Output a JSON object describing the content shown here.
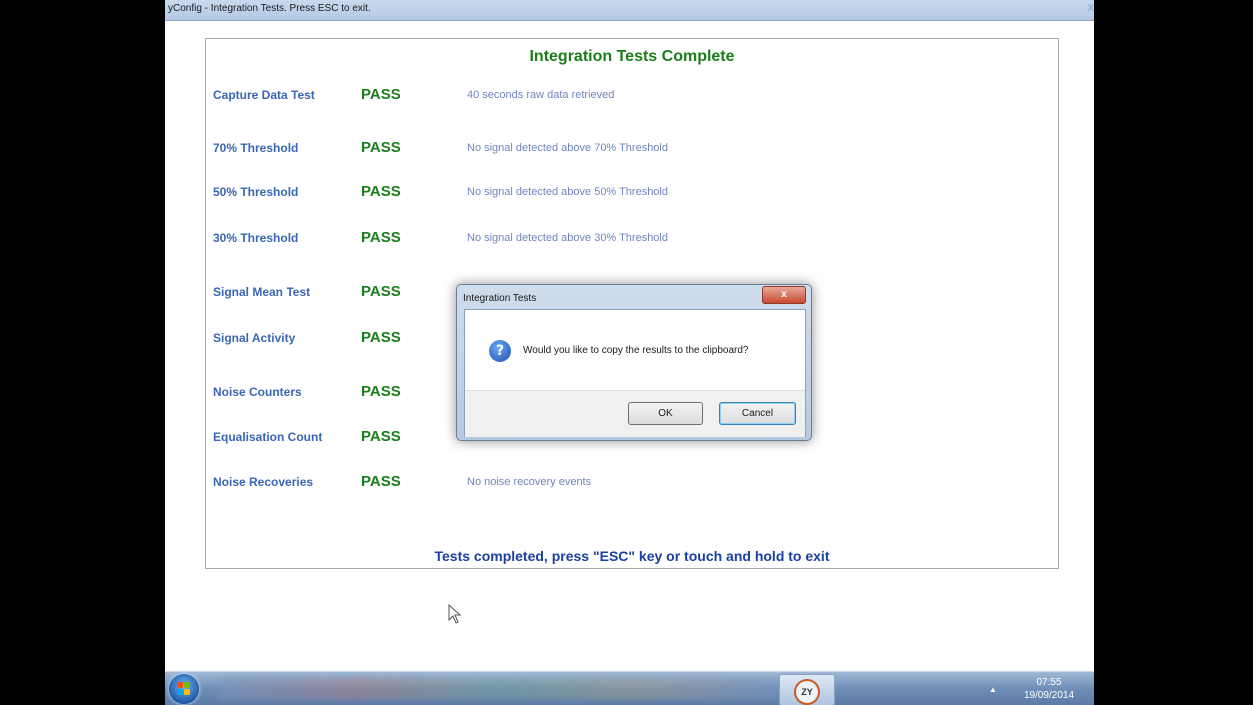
{
  "window": {
    "title": "yConfig - Integration Tests. Press ESC to exit.",
    "close_glyph": "X"
  },
  "panel": {
    "heading": "Integration Tests Complete",
    "rows": [
      {
        "name": "Capture Data Test",
        "status": "PASS",
        "detail": "40 seconds raw data retrieved"
      },
      {
        "name": "70% Threshold",
        "status": "PASS",
        "detail": "No signal detected above 70% Threshold"
      },
      {
        "name": "50% Threshold",
        "status": "PASS",
        "detail": "No signal detected above 50% Threshold"
      },
      {
        "name": "30% Threshold",
        "status": "PASS",
        "detail": "No signal detected above 30% Threshold"
      },
      {
        "name": "Signal Mean Test",
        "status": "PASS",
        "detail": ""
      },
      {
        "name": "Signal Activity",
        "status": "PASS",
        "detail": ""
      },
      {
        "name": "Noise Counters",
        "status": "PASS",
        "detail": ""
      },
      {
        "name": "Equalisation Count",
        "status": "PASS",
        "detail": ""
      },
      {
        "name": "Noise Recoveries",
        "status": "PASS",
        "detail": "No noise recovery events"
      }
    ],
    "footer": "Tests completed, press \"ESC\" key or touch and hold to exit"
  },
  "dialog": {
    "title": "Integration Tests",
    "close_glyph": "x",
    "icon": "question-icon",
    "message": "Would you like to copy the results to the clipboard?",
    "ok_label": "OK",
    "cancel_label": "Cancel"
  },
  "taskbar": {
    "app_label": "ZY",
    "tray_arrow": "▲",
    "time": "07:55",
    "date": "19/09/2014"
  },
  "colors": {
    "pass": "#1b7d1b",
    "test_name": "#3a66b5",
    "detail": "#6f86bd",
    "footer": "#1b3fa0"
  }
}
